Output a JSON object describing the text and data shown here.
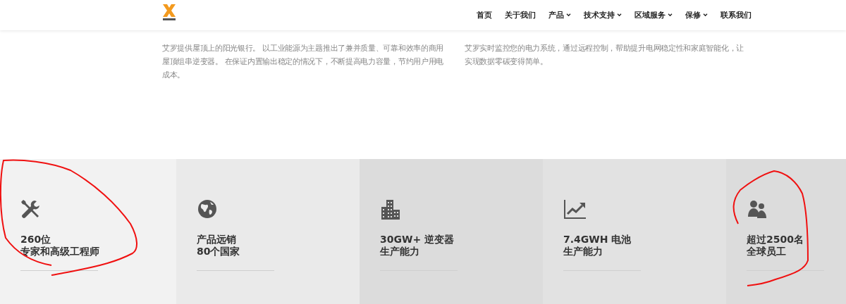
{
  "nav": [
    {
      "label": "首页",
      "has_menu": false
    },
    {
      "label": "关于我们",
      "has_menu": false
    },
    {
      "label": "产品",
      "has_menu": true
    },
    {
      "label": "技术支持",
      "has_menu": true
    },
    {
      "label": "区域服务",
      "has_menu": true
    },
    {
      "label": "保修",
      "has_menu": true
    },
    {
      "label": "联系我们",
      "has_menu": false
    }
  ],
  "features": [
    {
      "text": "艾罗提供屋顶上的阳光银行。 以工业能源为主题推出了兼并质量、可靠和效率的商用屋顶组串逆变器。 在保证内置输出稳定的情况下，不断提高电力容量，节约用户用电成本。"
    },
    {
      "text": "艾罗实时监控您的电力系统，通过远程控制，帮助提升电网稳定性和家庭智能化，让实现数据零碳变得简单。"
    }
  ],
  "stats": [
    {
      "kind": "tools",
      "lines": [
        "260位",
        "专家和高级工程师"
      ]
    },
    {
      "kind": "globe",
      "lines": [
        "产品远销",
        "80个国家"
      ]
    },
    {
      "kind": "buildings",
      "lines": [
        "30GW+ 逆变器",
        "生产能力"
      ]
    },
    {
      "kind": "chart",
      "lines": [
        "7.4GWH 电池",
        "生产能力"
      ]
    },
    {
      "kind": "users",
      "lines": [
        "超过2500名",
        "全球员工"
      ]
    }
  ]
}
